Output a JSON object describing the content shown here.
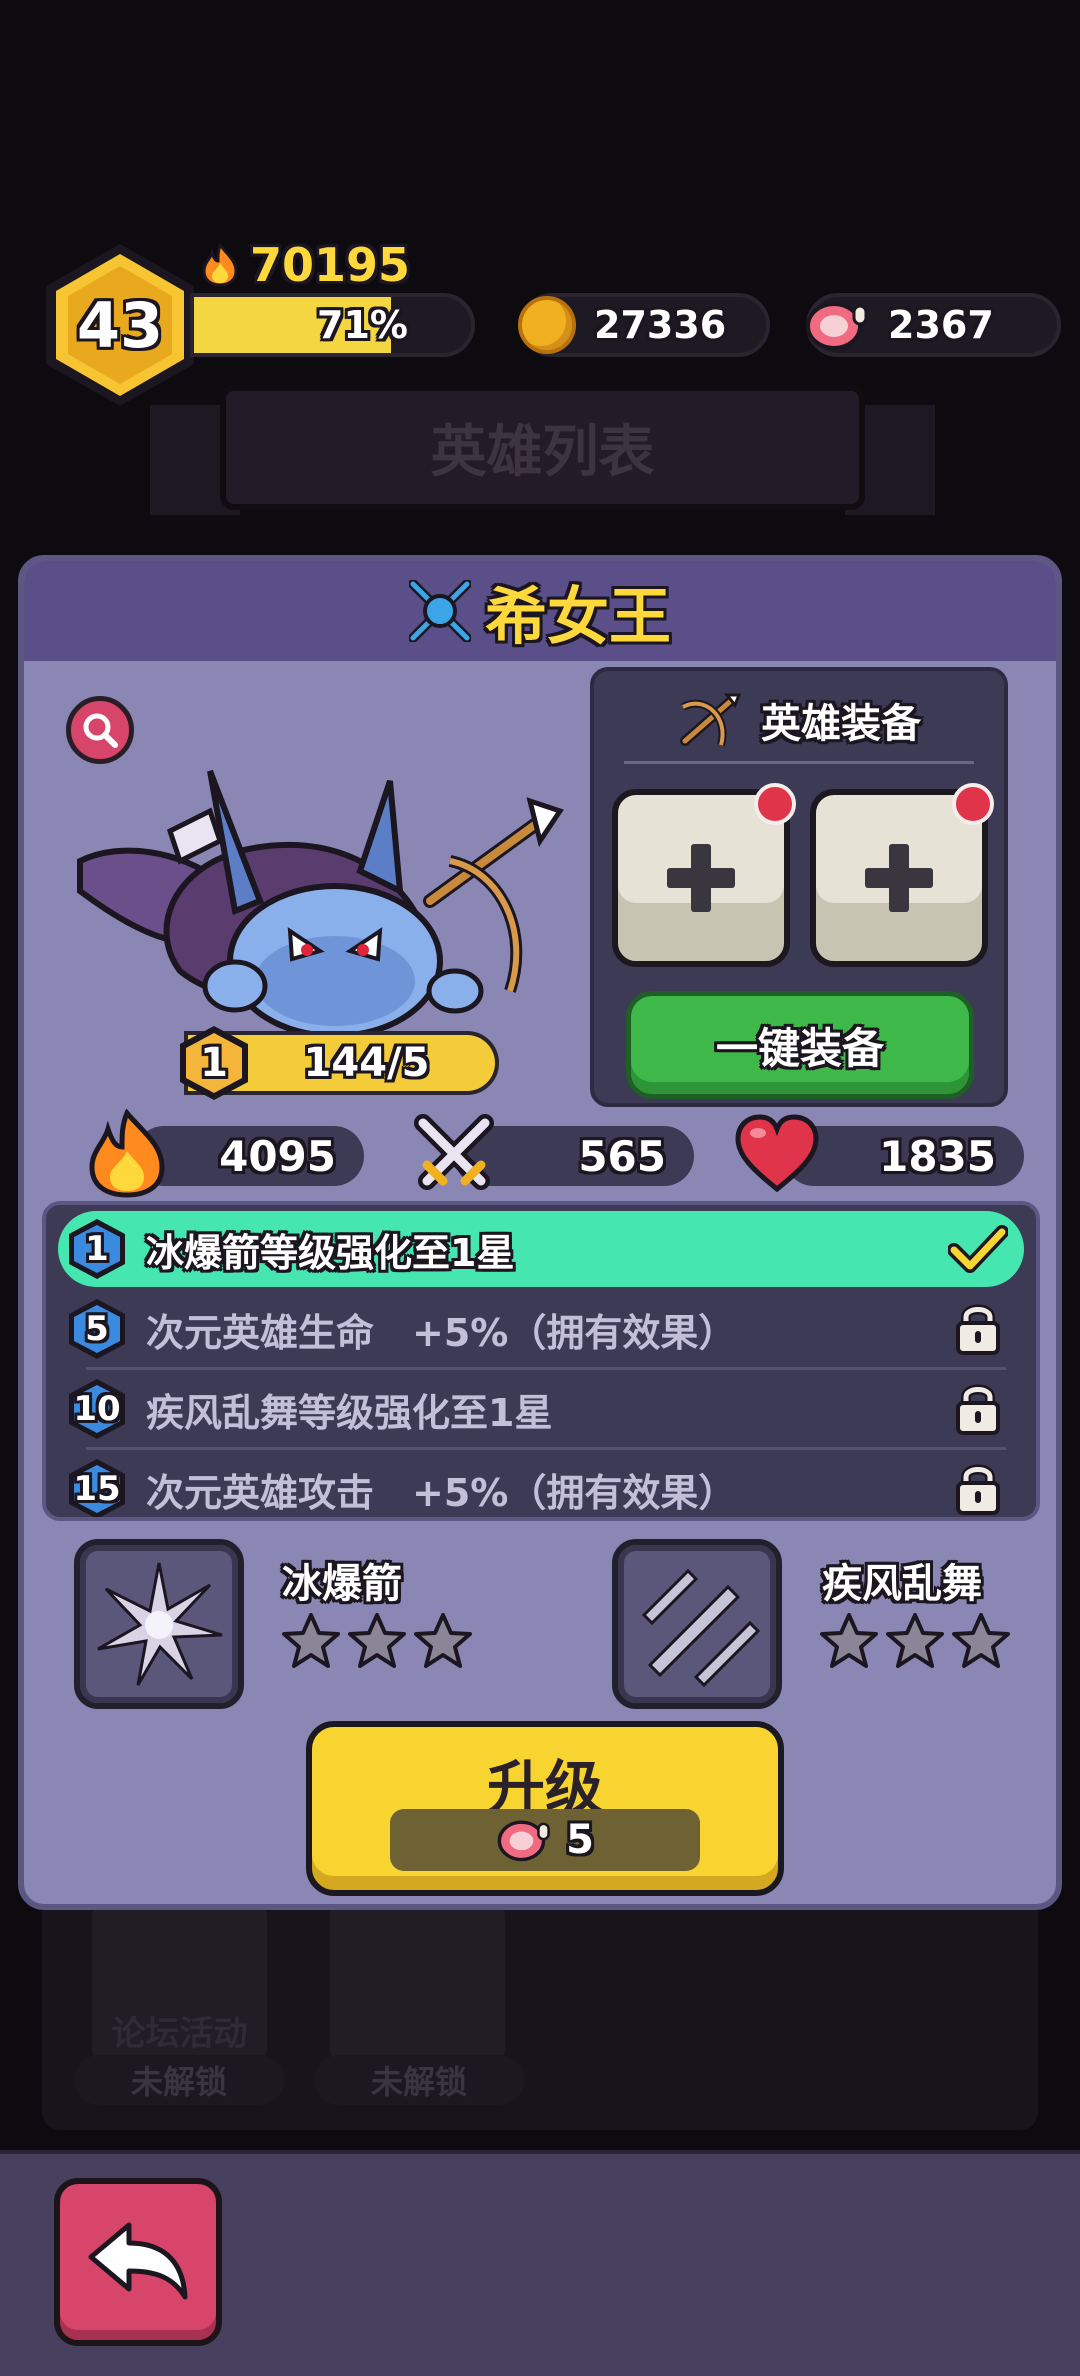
{
  "player": {
    "level": "43",
    "power": "70195",
    "xp_percent_text": "71%",
    "xp_fraction": 0.71
  },
  "resources": {
    "coins": "27336",
    "meat": "2367"
  },
  "background": {
    "title": "英雄列表",
    "cards": [
      {
        "label": "论坛活动",
        "status": "未解锁"
      },
      {
        "label": "",
        "status": "未解锁"
      }
    ]
  },
  "hero": {
    "name": "希女王",
    "level": "1",
    "progress_text": "144/5",
    "progress_fraction": 1.0,
    "stats": {
      "power": "4095",
      "attack": "565",
      "hp": "1835"
    }
  },
  "equipment": {
    "title": "英雄装备",
    "auto_equip_label": "一键装备"
  },
  "perks": [
    {
      "level": "1",
      "text": "冰爆箭等级强化至1星",
      "status": "unlocked"
    },
    {
      "level": "5",
      "text": "次元英雄生命　+5%（拥有效果）",
      "status": "locked"
    },
    {
      "level": "10",
      "text": "疾风乱舞等级强化至1星",
      "status": "locked"
    },
    {
      "level": "15",
      "text": "次元英雄攻击　+5%（拥有效果）",
      "status": "locked"
    }
  ],
  "skills": [
    {
      "name": "冰爆箭",
      "stars": 0,
      "max_stars": 3
    },
    {
      "name": "疾风乱舞",
      "stars": 0,
      "max_stars": 3
    }
  ],
  "upgrade": {
    "label": "升级",
    "cost": "5"
  },
  "colors": {
    "accent_yellow": "#ffd93b",
    "panel": "#8b87b5",
    "perk_active": "#45e6b0",
    "button_green": "#3fb84a",
    "button_red": "#d8456a"
  }
}
